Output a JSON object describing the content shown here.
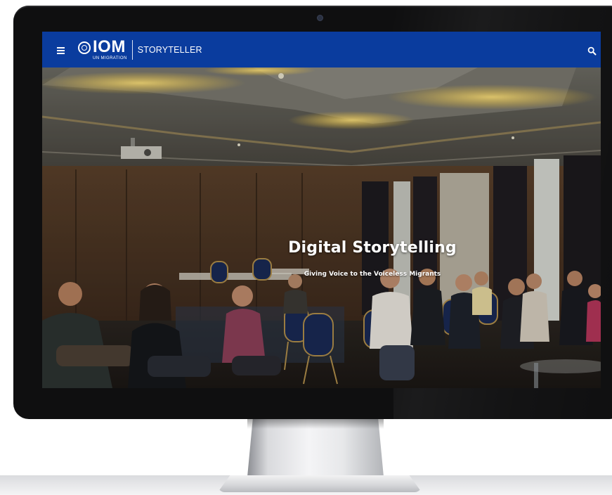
{
  "header": {
    "logo_main": "IOM",
    "logo_sub": "UN MIGRATION",
    "app_name": "STORYTELLER",
    "background_color": "#0a3c9e"
  },
  "hero": {
    "title": "Digital Storytelling",
    "subtitle": "Giving Voice to the Voiceless Migrants"
  },
  "icons": {
    "menu": "hamburger-menu-icon",
    "search": "search-icon",
    "logo": "iom-globe-logo"
  }
}
